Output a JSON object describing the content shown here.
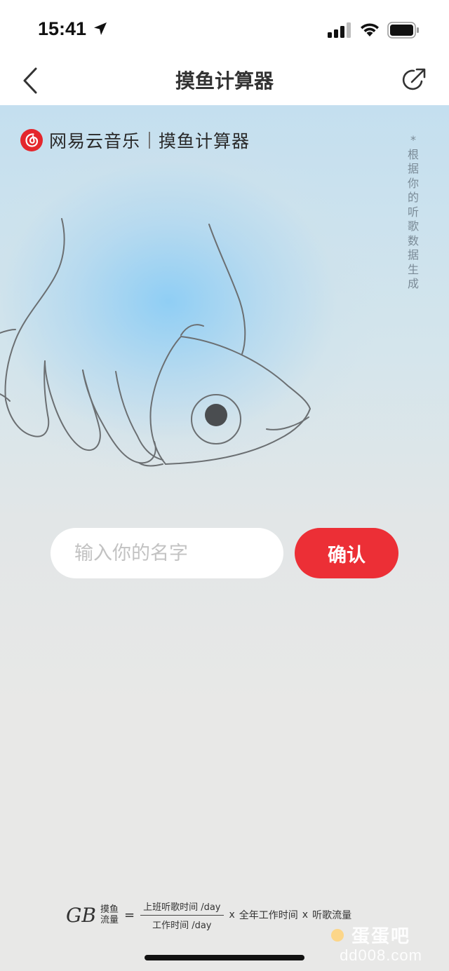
{
  "status_bar": {
    "time": "15:41"
  },
  "nav": {
    "title": "摸鱼计算器"
  },
  "brand": {
    "name": "网易云音乐",
    "subtitle": "摸鱼计算器"
  },
  "side_note": "*根据你的听歌数据生成",
  "form": {
    "name_placeholder": "输入你的名字",
    "name_value": "",
    "confirm_label": "确认"
  },
  "formula": {
    "gb": "GB",
    "sub_top": "摸鱼",
    "sub_bottom": "流量",
    "equals": "=",
    "numerator": "上班听歌时间 /day",
    "denominator": "工作时间 /day",
    "times": "x",
    "term1": "全年工作时间",
    "term2": "听歌流量"
  },
  "watermark": {
    "line1": "蛋蛋吧",
    "line2": "dd008.com"
  },
  "colors": {
    "accent": "#ec2f36",
    "sky_blue": "#8ccdf5",
    "paper": "#e8e8e7",
    "line_art": "#6b6f72"
  },
  "icons": [
    "location-arrow-icon",
    "signal-icon",
    "wifi-icon",
    "battery-icon",
    "back-arrow-icon",
    "share-icon",
    "netease-music-logo-icon"
  ]
}
